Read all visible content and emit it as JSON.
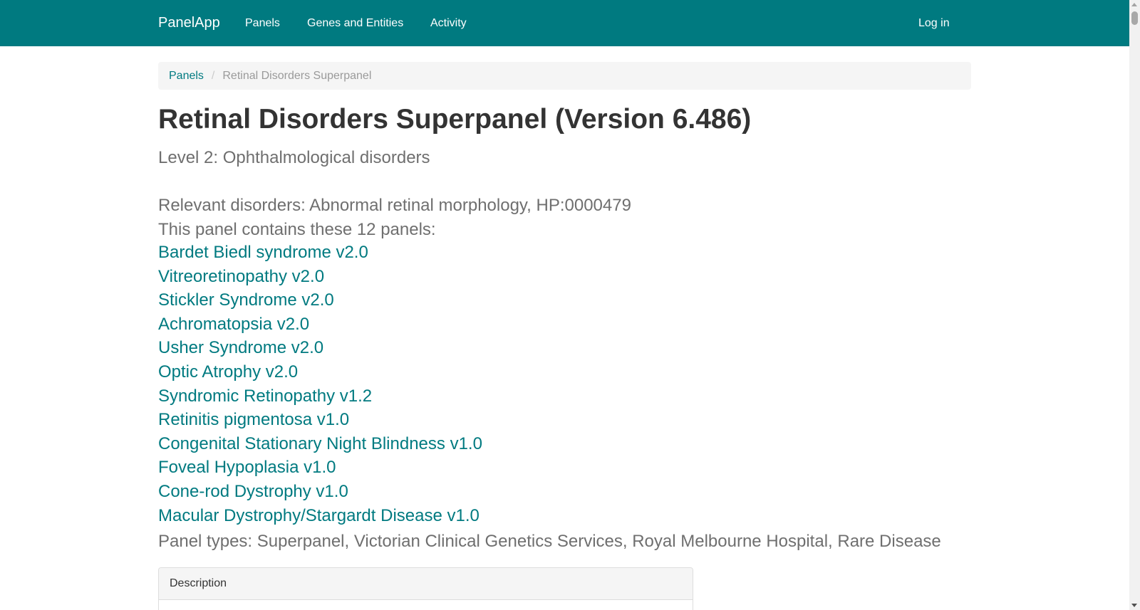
{
  "navbar": {
    "brand": "PanelApp",
    "links": [
      "Panels",
      "Genes and Entities",
      "Activity"
    ],
    "login": "Log in"
  },
  "breadcrumb": {
    "link": "Panels",
    "separator": "/",
    "active": "Retinal Disorders Superpanel"
  },
  "page": {
    "title": "Retinal Disorders Superpanel (Version 6.486)",
    "level": "Level 2: Ophthalmological disorders",
    "relevant_disorders": "Relevant disorders: Abnormal retinal morphology, HP:0000479",
    "contains": "This panel contains these 12 panels:",
    "panels": [
      "Bardet Biedl syndrome v2.0",
      "Vitreoretinopathy v2.0",
      "Stickler Syndrome v2.0",
      "Achromatopsia v2.0",
      "Usher Syndrome v2.0",
      "Optic Atrophy v2.0",
      "Syndromic Retinopathy v1.2",
      "Retinitis pigmentosa v1.0",
      "Congenital Stationary Night Blindness v1.0",
      "Foveal Hypoplasia v1.0",
      "Cone-rod Dystrophy v1.0",
      "Macular Dystrophy/Stargardt Disease v1.0"
    ],
    "panel_types": "Panel types: Superpanel, Victorian Clinical Genetics Services, Royal Melbourne Hospital, Rare Disease"
  },
  "description": {
    "header": "Description"
  },
  "colors": {
    "navbar_bg": "#007a80",
    "link": "#007a80",
    "muted_text": "#6f6f6f"
  }
}
